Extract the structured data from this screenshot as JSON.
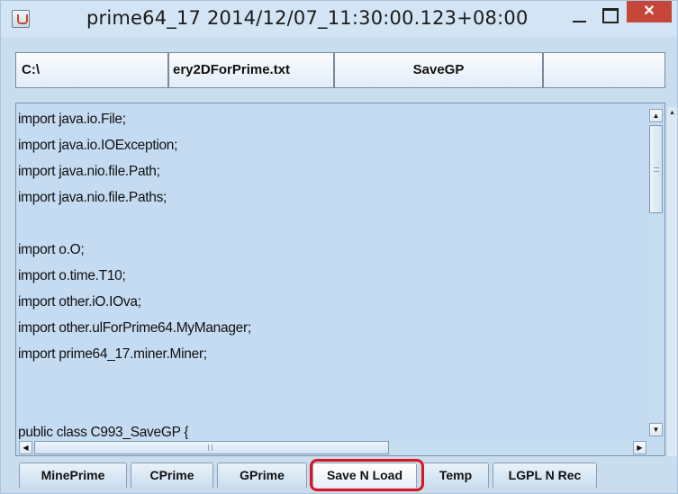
{
  "window": {
    "title": "prime64_17   2014/12/07_11:30:00.123+08:00",
    "app_icon": "java-cup-icon",
    "controls": {
      "minimize": "minimize-icon",
      "maximize": "maximize-icon",
      "close_label": "✕"
    },
    "accent_close": "#c7463a"
  },
  "toolbar": {
    "path_value": "C:\\",
    "file_value": "ery2DForPrime.txt",
    "save_label": "SaveGP",
    "extra_value": ""
  },
  "editor": {
    "lines": [
      "import java.io.File;",
      "import java.io.IOException;",
      "import java.nio.file.Path;",
      "import java.nio.file.Paths;",
      "",
      "import o.O;",
      "import o.time.T10;",
      "import other.iO.IOva;",
      "import other.ulForPrime64.MyManager;",
      "import prime64_17.miner.Miner;",
      "",
      "",
      "public class C993_SaveGP {"
    ],
    "scrollbar": {
      "up": "▲",
      "down": "▼",
      "left": "◀",
      "right": "▶"
    }
  },
  "tabs": [
    {
      "label": "MinePrime"
    },
    {
      "label": "CPrime"
    },
    {
      "label": "GPrime"
    },
    {
      "label": "Save N Load"
    },
    {
      "label": "Temp"
    },
    {
      "label": "LGPL N Rec"
    }
  ],
  "selected_tab": "Save N Load",
  "highlight_color": "#e0141e"
}
